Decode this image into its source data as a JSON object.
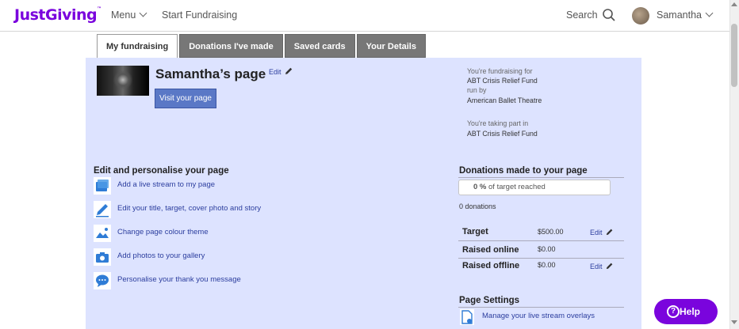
{
  "header": {
    "logo": "JustGiving",
    "logo_tm": "™",
    "menu_label": "Menu",
    "start_fundraising": "Start Fundraising",
    "search_label": "Search",
    "user_name": "Samantha"
  },
  "tabs": [
    {
      "label": "My fundraising"
    },
    {
      "label": "Donations I've made"
    },
    {
      "label": "Saved cards"
    },
    {
      "label": "Your Details"
    }
  ],
  "page": {
    "title": "Samantha’s page",
    "edit_label": "Edit",
    "visit_button": "Visit your page"
  },
  "fundraising_info": {
    "for_label": "You're fundraising for",
    "for_value": "ABT Crisis Relief Fund",
    "run_by_label": "run by",
    "run_by_value": "American Ballet Theatre",
    "taking_part_label": "You're taking part in",
    "taking_part_value": "ABT Crisis Relief Fund"
  },
  "personalise": {
    "heading": "Edit and personalise your page",
    "actions": [
      {
        "label": "Add a live stream to my page",
        "icon": "live-stream-icon"
      },
      {
        "label": "Edit your title, target, cover photo and story",
        "icon": "pencil-icon"
      },
      {
        "label": "Change page colour theme",
        "icon": "image-icon"
      },
      {
        "label": "Add photos to your gallery",
        "icon": "camera-icon"
      },
      {
        "label": "Personalise your thank you message",
        "icon": "chat-icon"
      }
    ]
  },
  "donations": {
    "heading": "Donations made to your page",
    "progress_value": "0 %",
    "progress_suffix": "of target reached",
    "count_text": "0 donations",
    "target_label": "Target",
    "target_value": "$500.00",
    "raised_online_label": "Raised online",
    "raised_online_value": "$0.00",
    "raised_offline_label": "Raised offline",
    "raised_offline_value": "$0.00",
    "edit_label": "Edit"
  },
  "settings": {
    "heading": "Page Settings",
    "manage_link": "Manage your live stream overlays"
  },
  "help": {
    "label": "Help"
  },
  "colors": {
    "brand": "#7a04dd",
    "panel": "#dde3ff",
    "link": "#2c3e9e",
    "button": "#5a78c6"
  }
}
